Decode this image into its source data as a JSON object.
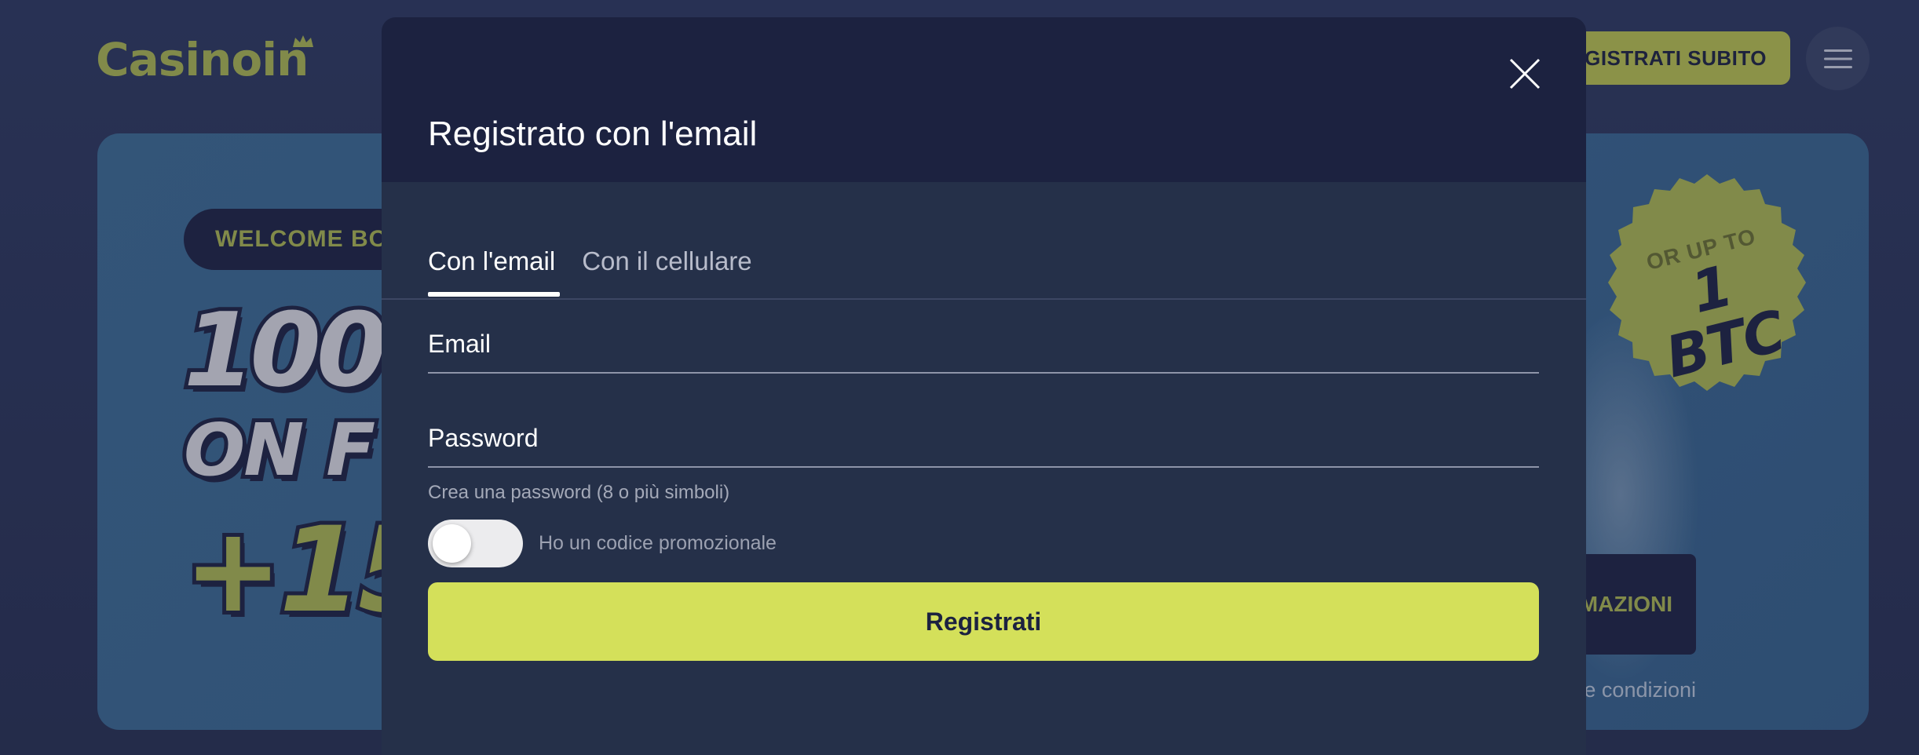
{
  "header": {
    "logo_text": "Casinoin",
    "register_now_label": "GISTRATI SUBITO"
  },
  "banner": {
    "welcome_label": "WELCOME BO",
    "line1": "100",
    "line2": "ON F",
    "line3": "+15",
    "seal_small": "OR UP TO",
    "seal_big": "1 BTC",
    "more_info_label": "Ù INFORMAZIONI",
    "terms_label": "Termini e condizioni"
  },
  "modal": {
    "title": "Registrato con l'email",
    "tabs": [
      {
        "label": "Con l'email",
        "active": true
      },
      {
        "label": "Con il cellulare",
        "active": false
      }
    ],
    "email_placeholder": "Email",
    "password_placeholder": "Password",
    "password_hint": "Crea una password (8 o più simboli)",
    "promo_label": "Ho un codice promozionale",
    "promo_enabled": false,
    "submit_label": "Registrati"
  },
  "colors": {
    "accent": "#d4e05a",
    "brand_olive": "#a9b452",
    "modal_bg": "#253049",
    "modal_header_bg": "#1c2240"
  }
}
